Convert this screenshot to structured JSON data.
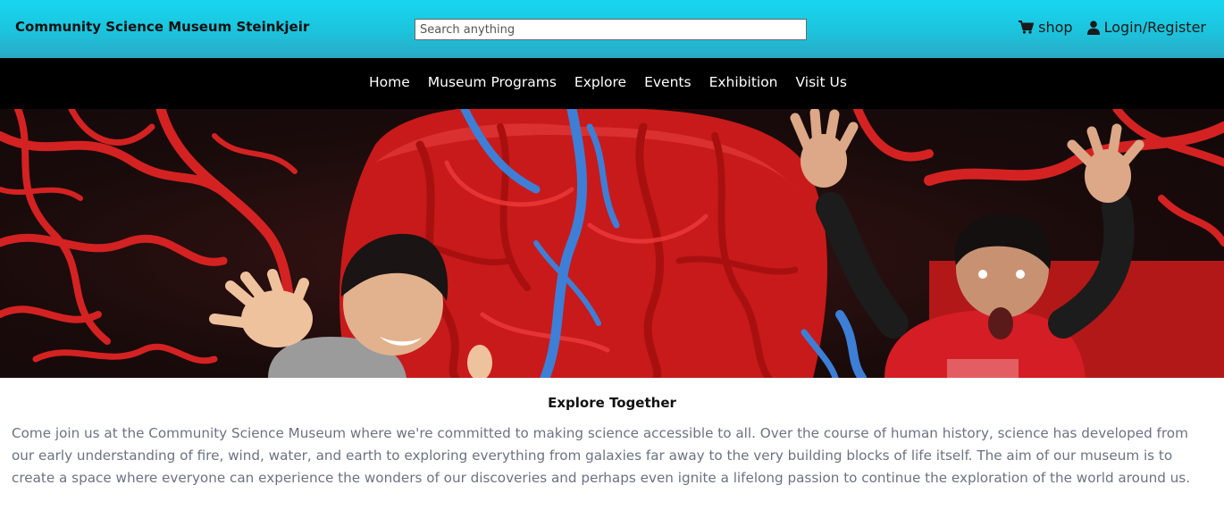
{
  "header": {
    "brand": "Community Science Museum Steinkjeir",
    "search_placeholder": "Search anything",
    "shop_label": "shop",
    "login_label": "Login/Register",
    "shop_icon": "cart-icon",
    "login_icon": "user-icon"
  },
  "nav": {
    "items": [
      "Home",
      "Museum Programs",
      "Explore",
      "Events",
      "Exhibition",
      "Visit Us"
    ]
  },
  "hero": {
    "image": "children-at-giant-heart-model-photo"
  },
  "content": {
    "title": "Explore Together",
    "body": "Come join us at the Community Science Museum where we're committed to making science accessible to all. Over the course of human history, science has developed from our early understanding of fire, wind, water, and earth to exploring everything from galaxies far away to the very building blocks of life itself. The aim of our museum is to create a space where everyone can experience the wonders of our discoveries and perhaps even ignite a lifelong passion to continue the exploration of the world around us."
  },
  "colors": {
    "topbar": "#18d6f0",
    "navbar": "#000000",
    "body_text": "#6b7382"
  }
}
